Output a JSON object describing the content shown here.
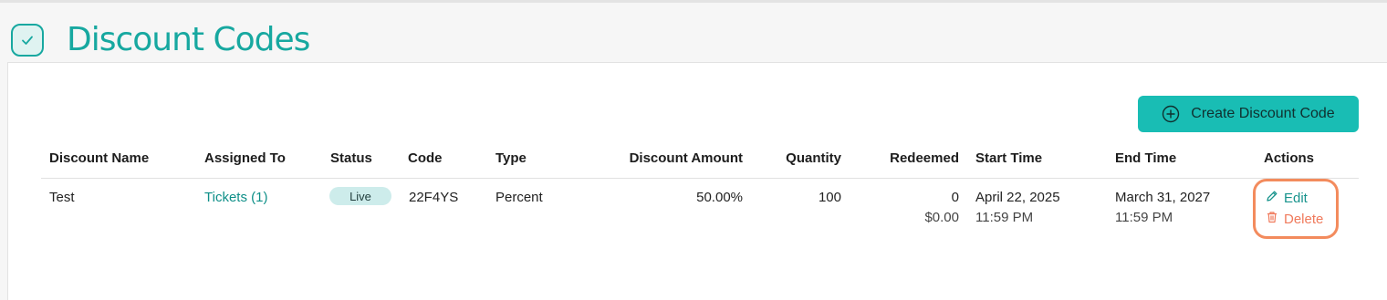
{
  "page": {
    "title": "Discount Codes",
    "icon": "checkmark-icon"
  },
  "toolbar": {
    "create_label": "Create Discount Code",
    "create_icon": "plus-circle-icon"
  },
  "table": {
    "headers": {
      "name": "Discount Name",
      "assigned": "Assigned To",
      "status": "Status",
      "code": "Code",
      "type": "Type",
      "amount": "Discount Amount",
      "quantity": "Quantity",
      "redeemed": "Redeemed",
      "start": "Start Time",
      "end": "End Time",
      "actions": "Actions"
    },
    "rows": [
      {
        "name": "Test",
        "assigned": "Tickets (1)",
        "status": "Live",
        "code": "22F4YS",
        "type": "Percent",
        "amount": "50.00%",
        "quantity": "100",
        "redeemed": "0",
        "redeemed_value": "$0.00",
        "start_date": "April 22, 2025",
        "start_time": "11:59 PM",
        "end_date": "March 31, 2027",
        "end_time": "11:59 PM",
        "edit_label": "Edit",
        "delete_label": "Delete"
      }
    ]
  },
  "colors": {
    "accent": "#17a8a0",
    "button": "#19bdb4",
    "danger": "#f07a5c",
    "highlight": "#f38b5d"
  }
}
